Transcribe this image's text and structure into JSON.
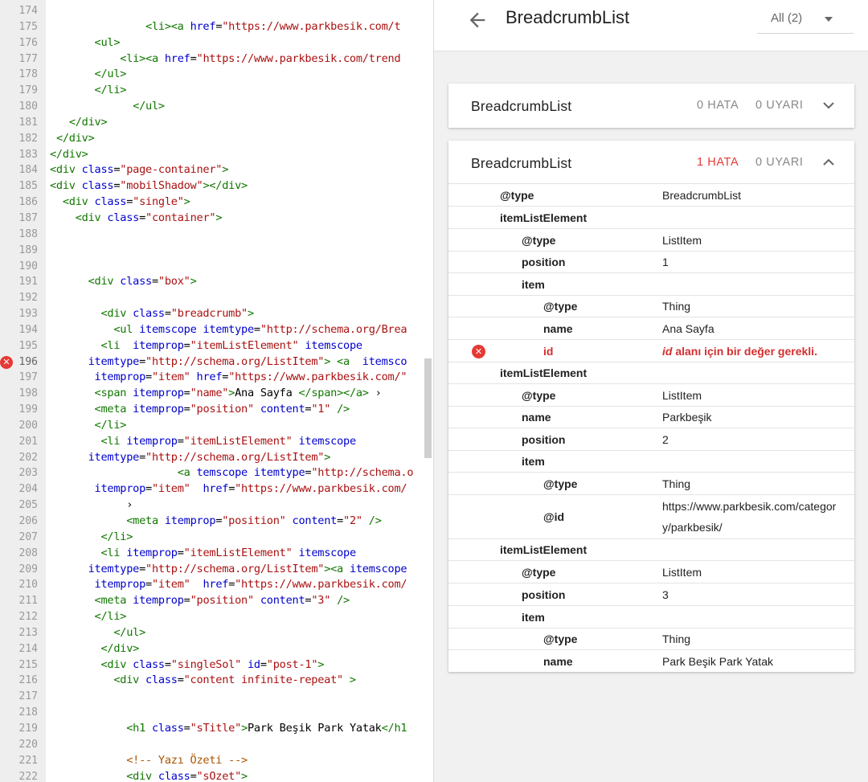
{
  "code": {
    "lines": [
      {
        "n": "174",
        "segs": []
      },
      {
        "n": "175",
        "segs": [
          [
            "text",
            "               "
          ],
          [
            "tag",
            "<li><a "
          ],
          [
            "attr",
            "href"
          ],
          [
            "text",
            "="
          ],
          [
            "str",
            "\"https://www.parkbesik.com/t"
          ]
        ]
      },
      {
        "n": "176",
        "segs": [
          [
            "text",
            "       "
          ],
          [
            "tag",
            "<ul>"
          ]
        ]
      },
      {
        "n": "177",
        "segs": [
          [
            "text",
            "           "
          ],
          [
            "tag",
            "<li><a "
          ],
          [
            "attr",
            "href"
          ],
          [
            "text",
            "="
          ],
          [
            "str",
            "\"https://www.parkbesik.com/trend"
          ]
        ]
      },
      {
        "n": "178",
        "segs": [
          [
            "text",
            "       "
          ],
          [
            "tag",
            "</ul>"
          ]
        ]
      },
      {
        "n": "179",
        "segs": [
          [
            "text",
            "       "
          ],
          [
            "tag",
            "</li>"
          ]
        ]
      },
      {
        "n": "180",
        "segs": [
          [
            "text",
            "             "
          ],
          [
            "tag",
            "</ul>"
          ]
        ]
      },
      {
        "n": "181",
        "segs": [
          [
            "text",
            "   "
          ],
          [
            "tag",
            "</div>"
          ]
        ]
      },
      {
        "n": "182",
        "segs": [
          [
            "text",
            " "
          ],
          [
            "tag",
            "</div>"
          ]
        ]
      },
      {
        "n": "183",
        "segs": [
          [
            "tag",
            "</div>"
          ]
        ]
      },
      {
        "n": "184",
        "segs": [
          [
            "tag",
            "<div "
          ],
          [
            "attr",
            "class"
          ],
          [
            "text",
            "="
          ],
          [
            "str",
            "\"page-container\""
          ],
          [
            "tag",
            ">"
          ]
        ]
      },
      {
        "n": "185",
        "segs": [
          [
            "tag",
            "<div "
          ],
          [
            "attr",
            "class"
          ],
          [
            "text",
            "="
          ],
          [
            "str",
            "\"mobilShadow\""
          ],
          [
            "tag",
            "></div>"
          ]
        ]
      },
      {
        "n": "186",
        "segs": [
          [
            "text",
            "  "
          ],
          [
            "tag",
            "<div "
          ],
          [
            "attr",
            "class"
          ],
          [
            "text",
            "="
          ],
          [
            "str",
            "\"single\""
          ],
          [
            "tag",
            ">"
          ]
        ]
      },
      {
        "n": "187",
        "segs": [
          [
            "text",
            "    "
          ],
          [
            "tag",
            "<div "
          ],
          [
            "attr",
            "class"
          ],
          [
            "text",
            "="
          ],
          [
            "str",
            "\"container\""
          ],
          [
            "tag",
            ">"
          ]
        ]
      },
      {
        "n": "188",
        "segs": []
      },
      {
        "n": "189",
        "segs": []
      },
      {
        "n": "190",
        "segs": []
      },
      {
        "n": "191",
        "segs": [
          [
            "text",
            "      "
          ],
          [
            "tag",
            "<div "
          ],
          [
            "attr",
            "class"
          ],
          [
            "text",
            "="
          ],
          [
            "str",
            "\"box\""
          ],
          [
            "tag",
            ">"
          ]
        ]
      },
      {
        "n": "192",
        "segs": []
      },
      {
        "n": "193",
        "segs": [
          [
            "text",
            "        "
          ],
          [
            "tag",
            "<div "
          ],
          [
            "attr",
            "class"
          ],
          [
            "text",
            "="
          ],
          [
            "str",
            "\"breadcrumb\""
          ],
          [
            "tag",
            ">"
          ]
        ]
      },
      {
        "n": "194",
        "segs": [
          [
            "text",
            "          "
          ],
          [
            "tag",
            "<ul "
          ],
          [
            "attr",
            "itemscope itemtype"
          ],
          [
            "text",
            "="
          ],
          [
            "str",
            "\"http://schema.org/Brea"
          ]
        ]
      },
      {
        "n": "195",
        "segs": [
          [
            "text",
            "        "
          ],
          [
            "tag",
            "<li  "
          ],
          [
            "attr",
            "itemprop"
          ],
          [
            "text",
            "="
          ],
          [
            "str",
            "\"itemListElement\""
          ],
          [
            "attr",
            " itemscope"
          ]
        ]
      },
      {
        "n": "196",
        "error": true,
        "segs": [
          [
            "text",
            "      "
          ],
          [
            "attr",
            "itemtype"
          ],
          [
            "text",
            "="
          ],
          [
            "str",
            "\"http://schema.org/ListItem\""
          ],
          [
            "tag",
            "> <a  "
          ],
          [
            "attr",
            "itemsco"
          ]
        ]
      },
      {
        "n": "197",
        "segs": [
          [
            "text",
            "       "
          ],
          [
            "attr",
            "itemprop"
          ],
          [
            "text",
            "="
          ],
          [
            "str",
            "\"item\""
          ],
          [
            "attr",
            " href"
          ],
          [
            "text",
            "="
          ],
          [
            "str",
            "\"https://www.parkbesik.com/\""
          ]
        ]
      },
      {
        "n": "198",
        "segs": [
          [
            "text",
            "       "
          ],
          [
            "tag",
            "<span "
          ],
          [
            "attr",
            "itemprop"
          ],
          [
            "text",
            "="
          ],
          [
            "str",
            "\"name\""
          ],
          [
            "tag",
            ">"
          ],
          [
            "text",
            "Ana Sayfa "
          ],
          [
            "tag",
            "</span></a>"
          ],
          [
            "text",
            " ›"
          ]
        ]
      },
      {
        "n": "199",
        "segs": [
          [
            "text",
            "       "
          ],
          [
            "tag",
            "<meta "
          ],
          [
            "attr",
            "itemprop"
          ],
          [
            "text",
            "="
          ],
          [
            "str",
            "\"position\""
          ],
          [
            "attr",
            " content"
          ],
          [
            "text",
            "="
          ],
          [
            "str",
            "\"1\""
          ],
          [
            "tag",
            " />"
          ]
        ]
      },
      {
        "n": "200",
        "segs": [
          [
            "text",
            "       "
          ],
          [
            "tag",
            "</li>"
          ]
        ]
      },
      {
        "n": "201",
        "segs": [
          [
            "text",
            "        "
          ],
          [
            "tag",
            "<li "
          ],
          [
            "attr",
            "itemprop"
          ],
          [
            "text",
            "="
          ],
          [
            "str",
            "\"itemListElement\""
          ],
          [
            "attr",
            " itemscope"
          ]
        ]
      },
      {
        "n": "202",
        "segs": [
          [
            "text",
            "      "
          ],
          [
            "attr",
            "itemtype"
          ],
          [
            "text",
            "="
          ],
          [
            "str",
            "\"http://schema.org/ListItem\""
          ],
          [
            "tag",
            ">"
          ]
        ]
      },
      {
        "n": "203",
        "segs": [
          [
            "text",
            "                    "
          ],
          [
            "tag",
            "<a "
          ],
          [
            "attr",
            "temscope itemtype"
          ],
          [
            "text",
            "="
          ],
          [
            "str",
            "\"http://schema.o"
          ]
        ]
      },
      {
        "n": "204",
        "segs": [
          [
            "text",
            "       "
          ],
          [
            "attr",
            "itemprop"
          ],
          [
            "text",
            "="
          ],
          [
            "str",
            "\"item\""
          ],
          [
            "attr",
            "  href"
          ],
          [
            "text",
            "="
          ],
          [
            "str",
            "\"https://www.parkbesik.com/"
          ]
        ]
      },
      {
        "n": "205",
        "segs": [
          [
            "text",
            "            ›"
          ]
        ]
      },
      {
        "n": "206",
        "segs": [
          [
            "text",
            "            "
          ],
          [
            "tag",
            "<meta "
          ],
          [
            "attr",
            "itemprop"
          ],
          [
            "text",
            "="
          ],
          [
            "str",
            "\"position\""
          ],
          [
            "attr",
            " content"
          ],
          [
            "text",
            "="
          ],
          [
            "str",
            "\"2\""
          ],
          [
            "tag",
            " />"
          ]
        ]
      },
      {
        "n": "207",
        "segs": [
          [
            "text",
            "        "
          ],
          [
            "tag",
            "</li>"
          ]
        ]
      },
      {
        "n": "208",
        "segs": [
          [
            "text",
            "        "
          ],
          [
            "tag",
            "<li "
          ],
          [
            "attr",
            "itemprop"
          ],
          [
            "text",
            "="
          ],
          [
            "str",
            "\"itemListElement\""
          ],
          [
            "attr",
            " itemscope"
          ]
        ]
      },
      {
        "n": "209",
        "segs": [
          [
            "text",
            "      "
          ],
          [
            "attr",
            "itemtype"
          ],
          [
            "text",
            "="
          ],
          [
            "str",
            "\"http://schema.org/ListItem\""
          ],
          [
            "tag",
            "><a "
          ],
          [
            "attr",
            "itemscope"
          ]
        ]
      },
      {
        "n": "210",
        "segs": [
          [
            "text",
            "       "
          ],
          [
            "attr",
            "itemprop"
          ],
          [
            "text",
            "="
          ],
          [
            "str",
            "\"item\""
          ],
          [
            "attr",
            "  href"
          ],
          [
            "text",
            "="
          ],
          [
            "str",
            "\"https://www.parkbesik.com/"
          ]
        ]
      },
      {
        "n": "211",
        "segs": [
          [
            "text",
            "       "
          ],
          [
            "tag",
            "<meta "
          ],
          [
            "attr",
            "itemprop"
          ],
          [
            "text",
            "="
          ],
          [
            "str",
            "\"position\""
          ],
          [
            "attr",
            " content"
          ],
          [
            "text",
            "="
          ],
          [
            "str",
            "\"3\""
          ],
          [
            "tag",
            " />"
          ]
        ]
      },
      {
        "n": "212",
        "segs": [
          [
            "text",
            "       "
          ],
          [
            "tag",
            "</li>"
          ]
        ]
      },
      {
        "n": "213",
        "segs": [
          [
            "text",
            "          "
          ],
          [
            "tag",
            "</ul>"
          ]
        ]
      },
      {
        "n": "214",
        "segs": [
          [
            "text",
            "        "
          ],
          [
            "tag",
            "</div>"
          ]
        ]
      },
      {
        "n": "215",
        "segs": [
          [
            "text",
            "        "
          ],
          [
            "tag",
            "<div "
          ],
          [
            "attr",
            "class"
          ],
          [
            "text",
            "="
          ],
          [
            "str",
            "\"singleSol\""
          ],
          [
            "attr",
            " id"
          ],
          [
            "text",
            "="
          ],
          [
            "str",
            "\"post-1\""
          ],
          [
            "tag",
            ">"
          ]
        ]
      },
      {
        "n": "216",
        "segs": [
          [
            "text",
            "          "
          ],
          [
            "tag",
            "<div "
          ],
          [
            "attr",
            "class"
          ],
          [
            "text",
            "="
          ],
          [
            "str",
            "\"content infinite-repeat\""
          ],
          [
            "tag",
            " >"
          ]
        ]
      },
      {
        "n": "217",
        "segs": []
      },
      {
        "n": "218",
        "segs": []
      },
      {
        "n": "219",
        "segs": [
          [
            "text",
            "            "
          ],
          [
            "tag",
            "<h1 "
          ],
          [
            "attr",
            "class"
          ],
          [
            "text",
            "="
          ],
          [
            "str",
            "\"sTitle\""
          ],
          [
            "tag",
            ">"
          ],
          [
            "text",
            "Park Beşik Park Yatak"
          ],
          [
            "tag",
            "</h1"
          ]
        ]
      },
      {
        "n": "220",
        "segs": []
      },
      {
        "n": "221",
        "segs": [
          [
            "text",
            "            "
          ],
          [
            "com",
            "<!-- Yazı Özeti -->"
          ]
        ]
      },
      {
        "n": "222",
        "segs": [
          [
            "text",
            "            "
          ],
          [
            "tag",
            "<div "
          ],
          [
            "attr",
            "class"
          ],
          [
            "text",
            "="
          ],
          [
            "str",
            "\"sOzet\""
          ],
          [
            "tag",
            ">"
          ]
        ]
      }
    ]
  },
  "header": {
    "title": "BreadcrumbList",
    "filter_value": "All (2)"
  },
  "cards": [
    {
      "title": "BreadcrumbList",
      "errors": "0 HATA",
      "warnings": "0 UYARI",
      "expanded": false
    },
    {
      "title": "BreadcrumbList",
      "errors": "1 HATA",
      "warnings": "0 UYARI",
      "expanded": true
    }
  ],
  "properties": [
    {
      "key": "@type",
      "value": "BreadcrumbList",
      "level": 0,
      "h": 28
    },
    {
      "key": "itemListElement",
      "value": "",
      "level": 0,
      "h": 28
    },
    {
      "key": "@type",
      "value": "ListItem",
      "level": 1,
      "h": 28
    },
    {
      "key": "position",
      "value": "1",
      "level": 1,
      "h": 27
    },
    {
      "key": "item",
      "value": "",
      "level": 1,
      "h": 28
    },
    {
      "key": "@type",
      "value": "Thing",
      "level": 2,
      "h": 27
    },
    {
      "key": "name",
      "value": "Ana Sayfa",
      "level": 2,
      "h": 28
    },
    {
      "key": "id",
      "value": " alanı için bir değer gerekli.",
      "value_em": "id",
      "level": 2,
      "h": 28,
      "error": true
    },
    {
      "key": "itemListElement",
      "value": "",
      "level": 0,
      "h": 27
    },
    {
      "key": "@type",
      "value": "ListItem",
      "level": 1,
      "h": 28
    },
    {
      "key": "name",
      "value": "Parkbeşik",
      "level": 1,
      "h": 27
    },
    {
      "key": "position",
      "value": "2",
      "level": 1,
      "h": 28
    },
    {
      "key": "item",
      "value": "",
      "level": 1,
      "h": 27
    },
    {
      "key": "@type",
      "value": "Thing",
      "level": 2,
      "h": 28
    },
    {
      "key": "@id",
      "value": "https://www.parkbesik.com/category/parkbesik/",
      "level": 2,
      "h": 55,
      "wrap": true
    },
    {
      "key": "itemListElement",
      "value": "",
      "level": 0,
      "h": 27
    },
    {
      "key": "@type",
      "value": "ListItem",
      "level": 1,
      "h": 28
    },
    {
      "key": "position",
      "value": "3",
      "level": 1,
      "h": 28
    },
    {
      "key": "item",
      "value": "",
      "level": 1,
      "h": 28
    },
    {
      "key": "@type",
      "value": "Thing",
      "level": 2,
      "h": 27
    },
    {
      "key": "name",
      "value": "Park Beşik Park Yatak",
      "level": 2,
      "h": 28
    }
  ],
  "colors": {
    "error": "#e53935",
    "tag": "#117700",
    "attr": "#0000cc",
    "string": "#aa1111"
  },
  "icons": {
    "back": "arrow-left-icon",
    "collapse": "chevron-up-icon",
    "expand": "chevron-down-icon",
    "error": "error-circle-icon"
  }
}
